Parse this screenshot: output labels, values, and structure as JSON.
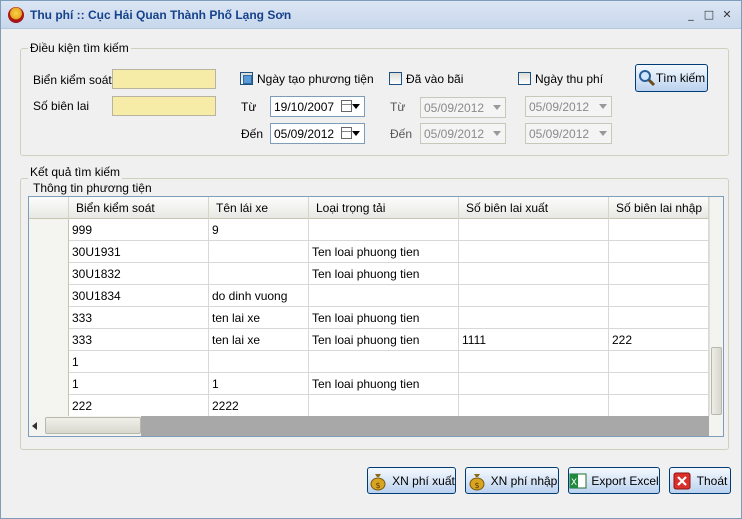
{
  "window": {
    "title": "Thu phí :: Cục Hải Quan Thành Phố Lạng Sơn",
    "min_icon": "minimize-icon",
    "max_icon": "maximize-icon",
    "close_icon": "close-icon"
  },
  "search": {
    "group_label": "Điều kiện tìm kiếm",
    "plate_label": "Biển kiểm soát",
    "plate_value": "",
    "receipt_label": "Số biên lai",
    "receipt_value": "",
    "created_label": "Ngày tạo phương tiện",
    "created_checked": true,
    "created_from_label": "Từ",
    "created_from": "19/10/2007",
    "created_to_label": "Đến",
    "created_to": "05/09/2012",
    "entered_label": "Đã vào bãi",
    "entered_checked": false,
    "entered_from_label": "Từ",
    "entered_from": "05/09/2012",
    "entered_to_label": "Đến",
    "entered_to": "05/09/2012",
    "fee_label": "Ngày thu phí",
    "fee_checked": false,
    "fee_from": "05/09/2012",
    "fee_to": "05/09/2012",
    "search_button": "Tìm kiếm"
  },
  "results": {
    "group_label": "Kết quả tìm kiếm",
    "subgroup_label": "Thông tin phương tiện",
    "columns": [
      "Biển kiểm soát",
      "Tên lái xe",
      "Loại trọng tải",
      "Số biên lai xuất",
      "Số biên lai nhập"
    ],
    "rows": [
      [
        "999",
        "9",
        "",
        "",
        ""
      ],
      [
        "30U1931",
        "",
        "Ten loai phuong tien",
        "",
        ""
      ],
      [
        "30U1832",
        "",
        "Ten loai phuong tien",
        "",
        ""
      ],
      [
        "30U1834",
        "do dinh vuong",
        "",
        "",
        ""
      ],
      [
        "333",
        "ten lai xe",
        "Ten loai phuong tien",
        "",
        ""
      ],
      [
        "333",
        "ten lai xe",
        "Ten loai phuong tien",
        "1111",
        "222"
      ],
      [
        "1",
        "",
        "",
        "",
        ""
      ],
      [
        "1",
        "1",
        "Ten loai phuong tien",
        "",
        ""
      ],
      [
        "222",
        "2222",
        "",
        "",
        ""
      ]
    ]
  },
  "actions": {
    "confirm_out": "XN phí xuất",
    "confirm_in": "XN phí nhập",
    "export": "Export Excel",
    "exit": "Thoát"
  }
}
